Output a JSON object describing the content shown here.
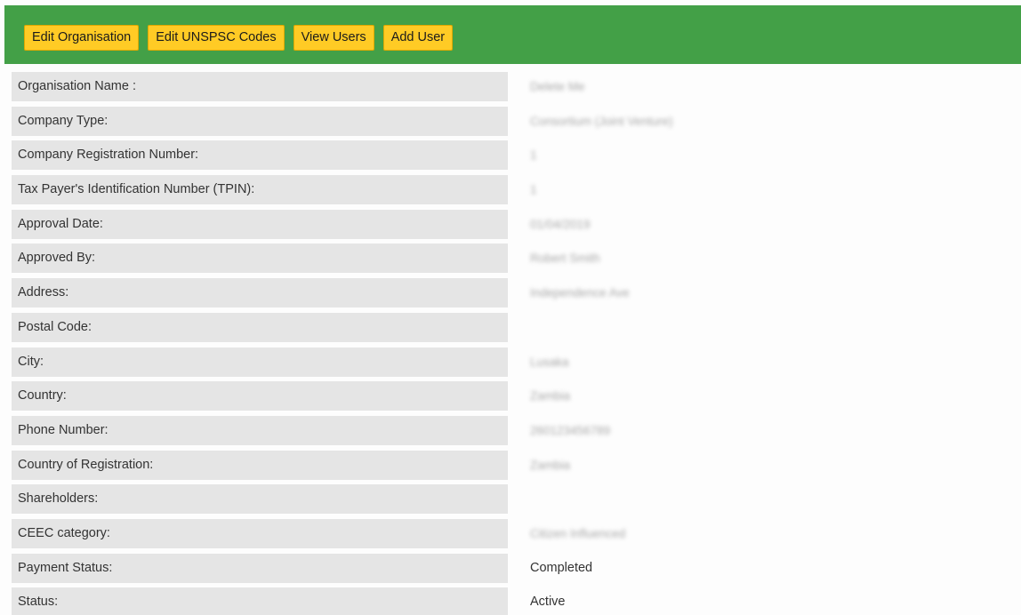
{
  "toolbar": {
    "buttons": [
      {
        "label": "Edit Organisation"
      },
      {
        "label": "Edit UNSPSC Codes"
      },
      {
        "label": "View Users"
      },
      {
        "label": "Add User"
      }
    ]
  },
  "details": {
    "rows": [
      {
        "label": "Organisation Name :",
        "value": "Delete Me"
      },
      {
        "label": "Company Type:",
        "value": "Consortium (Joint Venture)"
      },
      {
        "label": "Company Registration Number:",
        "value": "1"
      },
      {
        "label": "Tax Payer's Identification Number (TPIN):",
        "value": "1"
      },
      {
        "label": "Approval Date:",
        "value": "01/04/2019"
      },
      {
        "label": "Approved By:",
        "value": "Robert Smith"
      },
      {
        "label": "Address:",
        "value": "Independence Ave"
      },
      {
        "label": "Postal Code:",
        "value": ""
      },
      {
        "label": "City:",
        "value": "Lusaka"
      },
      {
        "label": "Country:",
        "value": "Zambia"
      },
      {
        "label": "Phone Number:",
        "value": "260123456789"
      },
      {
        "label": "Country of Registration:",
        "value": "Zambia"
      },
      {
        "label": "Shareholders:",
        "value": ""
      },
      {
        "label": "CEEC category:",
        "value": "Citizen Influenced"
      },
      {
        "label": "Payment Status:",
        "value": "Completed"
      },
      {
        "label": "Status:",
        "value": "Active"
      }
    ]
  },
  "colors": {
    "toolbar_bg": "#43a047",
    "button_bg": "#ffcb25",
    "label_bg": "#e5e5e5"
  }
}
